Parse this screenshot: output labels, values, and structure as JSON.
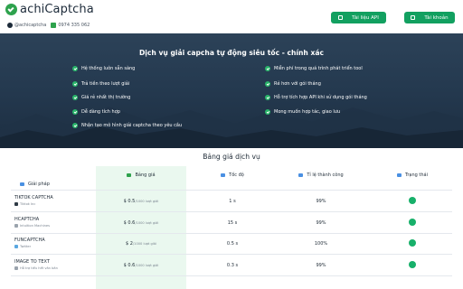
{
  "header": {
    "brand": "achiCaptcha",
    "handle": "@achicaptcha",
    "phone": "0974 335 062",
    "docs_label": "Tài liệu API",
    "account_label": "Tài khoản"
  },
  "hero": {
    "title": "Dịch vụ giải capcha tự động siêu tốc - chính xác",
    "features_left": [
      "Hệ thống luôn sẵn sàng",
      "Trả tiền theo lượt giải",
      "Giá rẻ nhất thị trường",
      "Dễ dàng tích hợp",
      "Nhận tạo mô hình giải captcha theo yêu cầu"
    ],
    "features_right": [
      "Miễn phí trong quá trình phát triển tool",
      "Rẻ hơn với gói tháng",
      "Hỗ trợ tích hợp API khi sử dụng gói tháng",
      "Mong muốn hợp tác, giao lưu"
    ]
  },
  "pricing": {
    "title": "Bảng giá dịch vụ",
    "headers": {
      "plan": "Giải pháp",
      "price": "Bảng giá",
      "speed": "Tốc độ",
      "success": "Tỉ lệ thành công",
      "status": "Trạng thái"
    },
    "rows": [
      {
        "name": "TIKTOK CAPTCHA",
        "sub": "Tiktok Inc",
        "price": "$ 0.5",
        "unit": "/1000 lượt giải",
        "speed": "1 s",
        "success": "99%",
        "status_color": "#17b06a"
      },
      {
        "name": "HCAPTCHA",
        "sub": "Intuition Machines",
        "price": "$ 0.6",
        "unit": "/1000 lượt giải",
        "speed": "15 s",
        "success": "99%",
        "status_color": "#17b06a"
      },
      {
        "name": "FUNCAPTCHA",
        "sub": "Twitter",
        "price": "$ 2",
        "unit": "/1000 lượt giải",
        "speed": "0.5 s",
        "success": "100%",
        "status_color": "#17b06a"
      },
      {
        "name": "IMAGE TO TEXT",
        "sub": "Hỗ trợ tiếu hết văn bản",
        "price": "$ 0.6",
        "unit": "/1000 lượt giải",
        "speed": "0.3 s",
        "success": "99%",
        "status_color": "#17b06a"
      }
    ]
  },
  "colors": {
    "accent": "#12a060",
    "hero_bg": "#253a50",
    "highlight": "#eaf8ef"
  }
}
